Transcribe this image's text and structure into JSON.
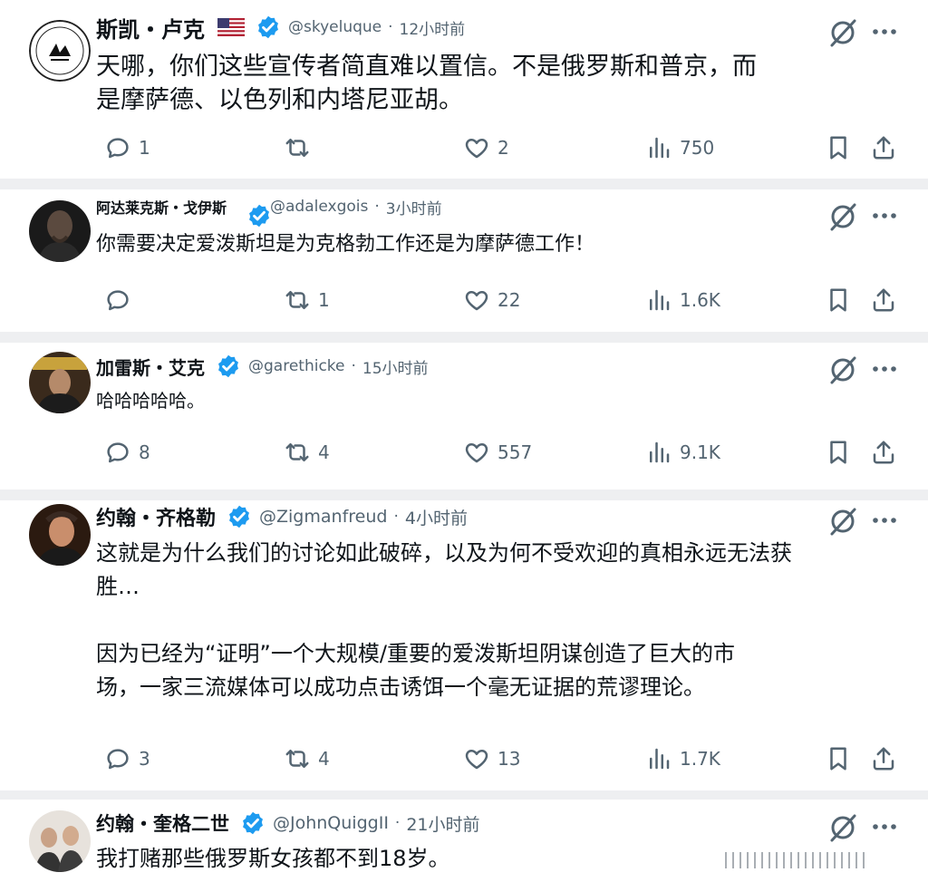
{
  "posts": [
    {
      "name": "斯凯・卢克",
      "handle": "@skyeluque",
      "time": "12小时前",
      "has_flag": true,
      "text": [
        "天哪，你们这些宣传者简直难以置信。不是俄罗斯和普京，而",
        "是摩萨德、以色列和内塔尼亚胡。"
      ],
      "replies": "1",
      "retweets": "",
      "likes": "2",
      "views": "750"
    },
    {
      "name": "阿达莱克斯・戈伊斯",
      "handle": "@adalexgois",
      "time": "3小时前",
      "text": [
        "你需要决定爱泼斯坦是为克格勃工作还是为摩萨德工作！"
      ],
      "replies": "",
      "retweets": "1",
      "likes": "22",
      "views": "1.6K"
    },
    {
      "name": "加雷斯・艾克",
      "handle": "@garethicke",
      "time": "15小时前",
      "text": [
        "哈哈哈哈哈。"
      ],
      "replies": "8",
      "retweets": "4",
      "likes": "557",
      "views": "9.1K"
    },
    {
      "name": "约翰・齐格勒",
      "handle": "@Zigmanfreud",
      "time": "4小时前",
      "text": [
        "这就是为什么我们的讨论如此破碎，以及为何不受欢迎的真相永远无法获",
        "胜…",
        "",
        "因为已经为“证明”一个大规模/重要的爱泼斯坦阴谋创造了巨大的市",
        "场，一家三流媒体可以成功点击诱饵一个毫无证据的荒谬理论。"
      ],
      "replies": "3",
      "retweets": "4",
      "likes": "13",
      "views": "1.7K"
    },
    {
      "name": "约翰・奎格二世",
      "handle": "@JohnQuiggII",
      "time": "21小时前",
      "text": [
        "我打赌那些俄罗斯女孩都不到18岁。"
      ]
    }
  ],
  "separator": "·",
  "icons": {
    "reply": "reply-icon",
    "retweet": "retweet-icon",
    "like": "heart-icon",
    "views": "views-icon",
    "bookmark": "bookmark-icon",
    "share": "share-icon",
    "grok": "grok-icon",
    "more": "more-icon",
    "verified": "verified-badge-icon"
  },
  "colors": {
    "text": "#0f1419",
    "secondary": "#536471",
    "verified": "#1d9bf0",
    "separator": "#eeeff1"
  }
}
